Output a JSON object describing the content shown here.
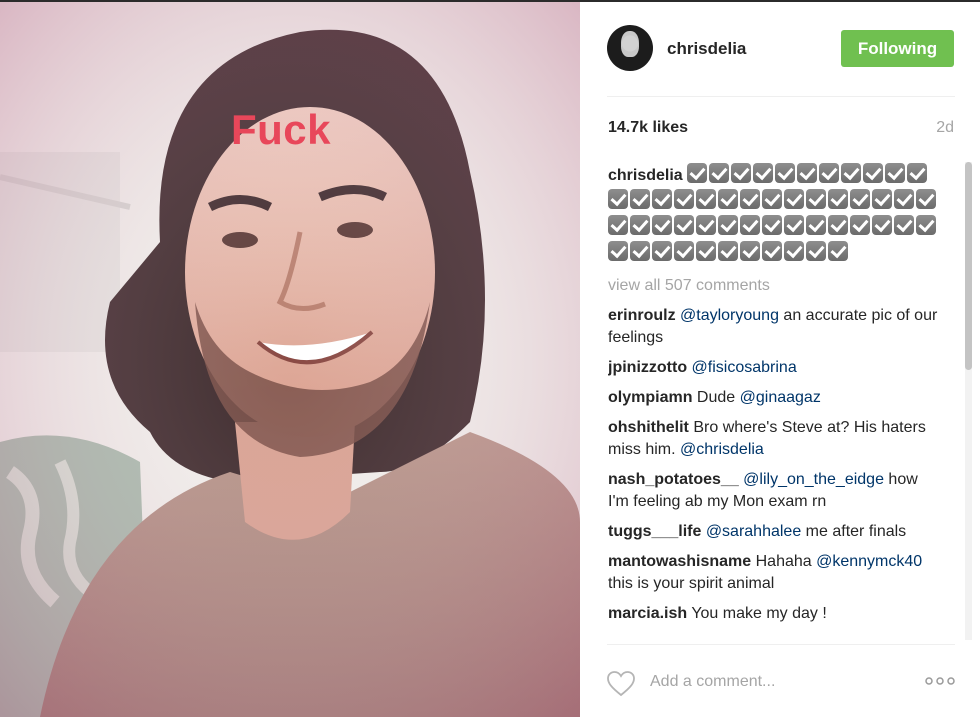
{
  "post": {
    "image_text": "Fuck",
    "username": "chrisdelia",
    "follow_label": "Following",
    "likes": "14.7k likes",
    "age": "2d"
  },
  "caption": {
    "username": "chrisdelia",
    "checkmark_count": 52,
    "icon": "checkmark-box-icon"
  },
  "view_all": "view all 507 comments",
  "comments": [
    {
      "user": "erinroulz",
      "parts": [
        {
          "t": "mention",
          "v": "@tayloryoung"
        },
        {
          "t": "text",
          "v": " an accurate pic of our feelings"
        }
      ]
    },
    {
      "user": "jpinizzotto",
      "parts": [
        {
          "t": "mention",
          "v": "@fisicosabrina"
        }
      ]
    },
    {
      "user": "olympiamn",
      "parts": [
        {
          "t": "text",
          "v": "Dude "
        },
        {
          "t": "mention",
          "v": "@ginaagaz"
        }
      ]
    },
    {
      "user": "ohshithelit",
      "parts": [
        {
          "t": "text",
          "v": "Bro where's Steve at? His haters miss him. "
        },
        {
          "t": "mention",
          "v": "@chrisdelia"
        }
      ]
    },
    {
      "user": "nash_potatoes__",
      "parts": [
        {
          "t": "mention",
          "v": "@lily_on_the_eidge"
        },
        {
          "t": "text",
          "v": " how I'm feeling ab my Mon exam rn"
        }
      ]
    },
    {
      "user": "tuggs___life",
      "parts": [
        {
          "t": "mention",
          "v": "@sarahhalee"
        },
        {
          "t": "text",
          "v": " me after finals"
        }
      ]
    },
    {
      "user": "mantowashisname",
      "parts": [
        {
          "t": "text",
          "v": "Hahaha "
        },
        {
          "t": "mention",
          "v": "@kennymck40"
        },
        {
          "t": "text",
          "v": " this is your spirit animal"
        }
      ]
    },
    {
      "user": "marcia.ish",
      "parts": [
        {
          "t": "text",
          "v": "You make my day !"
        }
      ]
    }
  ],
  "footer": {
    "comment_placeholder": "Add a comment...",
    "like_icon": "heart-icon",
    "more_icon": "more-options-icon"
  },
  "colors": {
    "follow_button": "#70c050",
    "mention": "#003569",
    "caption_overlay": "#e8475a",
    "muted": "#a5a5a5"
  }
}
